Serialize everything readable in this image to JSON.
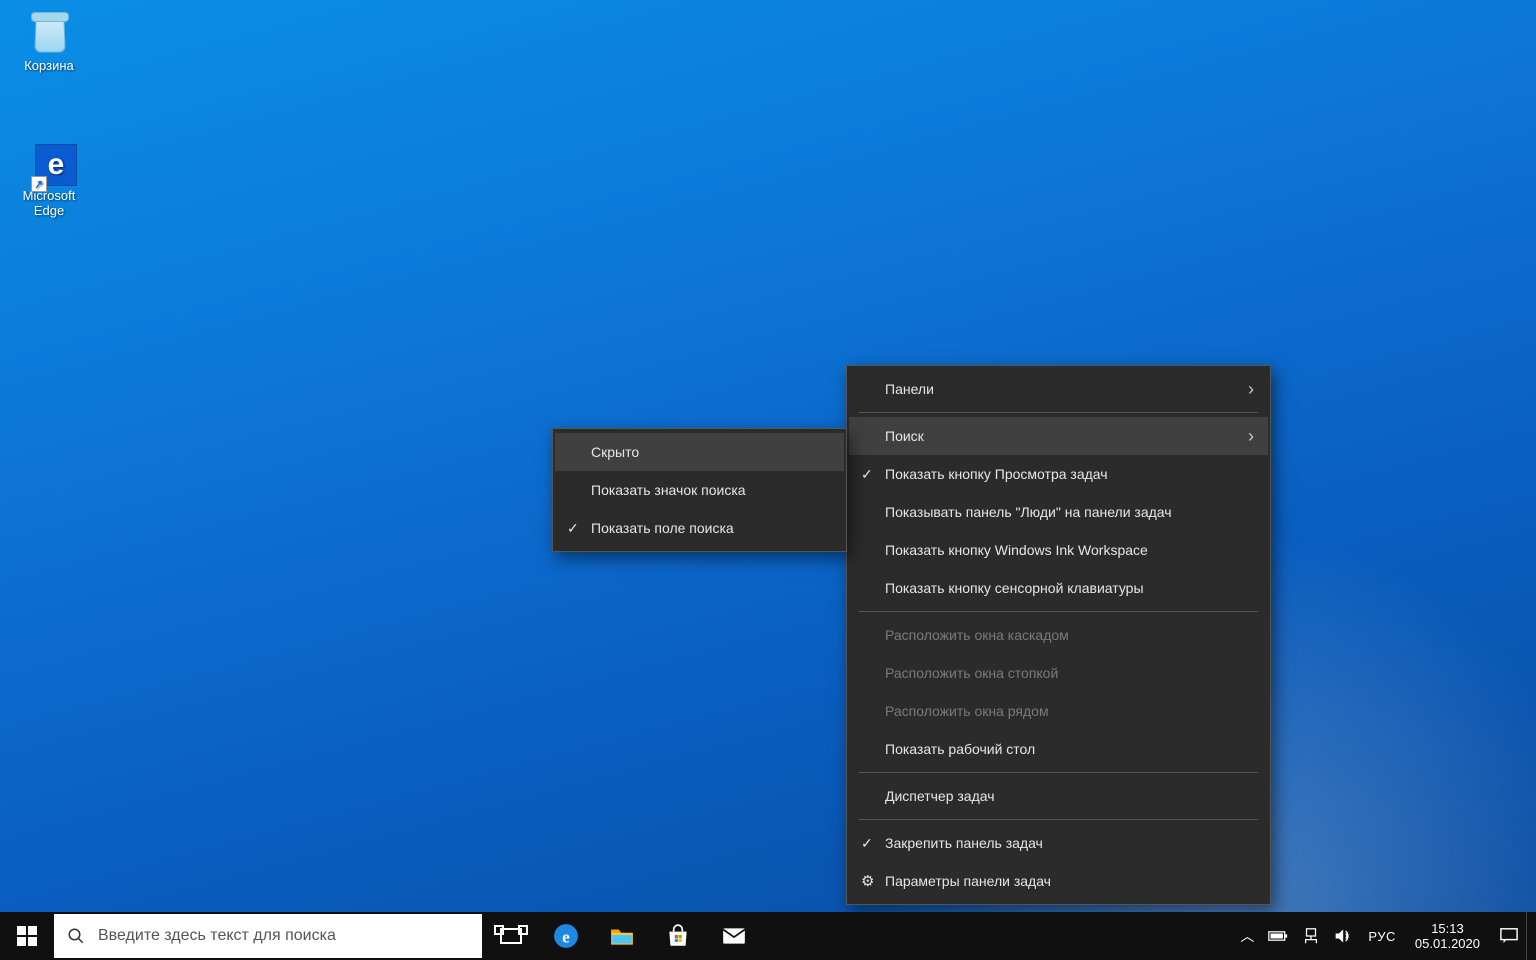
{
  "desktop": {
    "icons": [
      {
        "id": "recycle-bin",
        "label": "Корзина"
      },
      {
        "id": "edge",
        "label": "Microsoft\nEdge"
      }
    ]
  },
  "searchPlaceholder": "Введите здесь текст для поиска",
  "tray": {
    "language": "РУС",
    "time": "15:13",
    "date": "05.01.2020"
  },
  "contextMenu": {
    "panels": "Панели",
    "search": "Поиск",
    "showTaskViewBtn": "Показать кнопку Просмотра задач",
    "showPeoplePanel": "Показывать панель \"Люди\" на панели задач",
    "showInkWorkspaceBtn": "Показать кнопку Windows Ink Workspace",
    "showTouchKbBtn": "Показать кнопку сенсорной клавиатуры",
    "cascade": "Расположить окна каскадом",
    "stack": "Расположить окна стопкой",
    "sideBySide": "Расположить окна рядом",
    "showDesktop": "Показать рабочий стол",
    "taskManager": "Диспетчер задач",
    "lockTaskbar": "Закрепить панель задач",
    "taskbarSettings": "Параметры панели задач"
  },
  "searchSubmenu": {
    "hidden": "Скрыто",
    "showIcon": "Показать значок поиска",
    "showBox": "Показать поле поиска"
  }
}
